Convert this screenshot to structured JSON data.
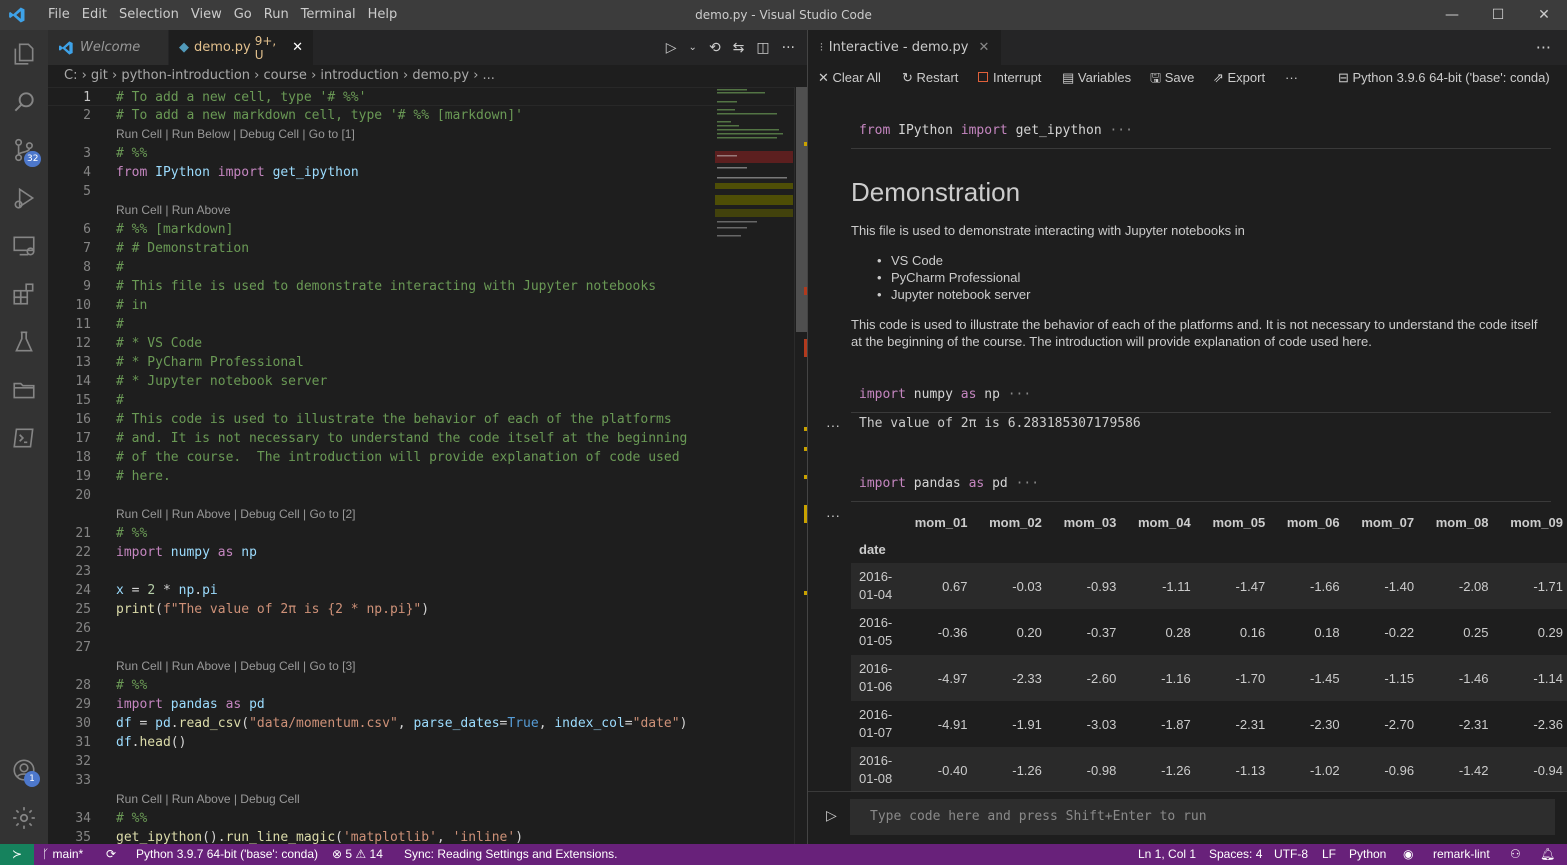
{
  "titlebar": {
    "menu": [
      "File",
      "Edit",
      "Selection",
      "View",
      "Go",
      "Run",
      "Terminal",
      "Help"
    ],
    "title": "demo.py - Visual Studio Code",
    "minimize": "—",
    "maximize": "☐",
    "close": "✕"
  },
  "tabs": {
    "welcome": "Welcome",
    "demo": "demo.py",
    "demo_status": "9+, U",
    "close": "✕"
  },
  "breadcrumb": "C: › git › python-introduction › course › introduction › demo.py › ...",
  "activity": {
    "scm_badge": "32",
    "accounts_badge": "1"
  },
  "editor": {
    "lines": [
      {
        "n": "1",
        "code": "# To add a new cell, type '# %%'"
      },
      {
        "n": "2",
        "code": "# To add a new markdown cell, type '# %% [markdown]'"
      },
      {
        "lens": "Run Cell | Run Below | Debug Cell | Go to [1]"
      },
      {
        "n": "3",
        "code": "# %%"
      },
      {
        "n": "4",
        "code": "from IPython import get_ipython"
      },
      {
        "n": "5",
        "code": ""
      },
      {
        "lens": "Run Cell | Run Above"
      },
      {
        "n": "6",
        "code": "# %% [markdown]"
      },
      {
        "n": "7",
        "code": "# # Demonstration"
      },
      {
        "n": "8",
        "code": "#"
      },
      {
        "n": "9",
        "code": "# This file is used to demonstrate interacting with Jupyter notebooks"
      },
      {
        "n": "10",
        "code": "# in"
      },
      {
        "n": "11",
        "code": "#"
      },
      {
        "n": "12",
        "code": "# * VS Code"
      },
      {
        "n": "13",
        "code": "# * PyCharm Professional"
      },
      {
        "n": "14",
        "code": "# * Jupyter notebook server"
      },
      {
        "n": "15",
        "code": "#"
      },
      {
        "n": "16",
        "code": "# This code is used to illustrate the behavior of each of the platforms"
      },
      {
        "n": "17",
        "code": "# and. It is not necessary to understand the code itself at the beginning"
      },
      {
        "n": "18",
        "code": "# of the course.  The introduction will provide explanation of code used"
      },
      {
        "n": "19",
        "code": "# here."
      },
      {
        "n": "20",
        "code": ""
      },
      {
        "lens": "Run Cell | Run Above | Debug Cell | Go to [2]"
      },
      {
        "n": "21",
        "code": "# %%"
      },
      {
        "n": "22",
        "code": "import numpy as np"
      },
      {
        "n": "23",
        "code": ""
      },
      {
        "n": "24",
        "code": "x = 2 * np.pi"
      },
      {
        "n": "25",
        "code": "print(f\"The value of 2π is {2 * np.pi}\")"
      },
      {
        "n": "26",
        "code": ""
      },
      {
        "n": "27",
        "code": ""
      },
      {
        "lens": "Run Cell | Run Above | Debug Cell | Go to [3]"
      },
      {
        "n": "28",
        "code": "# %%"
      },
      {
        "n": "29",
        "code": "import pandas as pd"
      },
      {
        "n": "30",
        "code": "df = pd.read_csv(\"data/momentum.csv\", parse_dates=True, index_col=\"date\")"
      },
      {
        "n": "31",
        "code": "df.head()"
      },
      {
        "n": "32",
        "code": ""
      },
      {
        "n": "33",
        "code": ""
      },
      {
        "lens": "Run Cell | Run Above | Debug Cell"
      },
      {
        "n": "34",
        "code": "# %%"
      },
      {
        "n": "35",
        "code": "get_ipython().run_line_magic('matplotlib', 'inline')"
      }
    ]
  },
  "interactive": {
    "tab": "Interactive - demo.py",
    "toolbar": {
      "clear": "Clear All",
      "restart": "Restart",
      "interrupt": "Interrupt",
      "variables": "Variables",
      "save": "Save",
      "export": "Export",
      "more": "···",
      "kernel": "Python 3.9.6 64-bit ('base': conda)"
    },
    "cell1": "from IPython import get_ipython ···",
    "md_title": "Demonstration",
    "md_p1": "This file is used to demonstrate interacting with Jupyter notebooks in",
    "md_list": [
      "VS Code",
      "PyCharm Professional",
      "Jupyter notebook server"
    ],
    "md_p2": "This code is used to illustrate the behavior of each of the platforms and. It is not necessary to understand the code itself at the beginning of the course. The introduction will provide explanation of code used here.",
    "cell2": "import numpy as np ···",
    "out2": "The value of 2π is 6.283185307179586",
    "cell3": "import pandas as pd ···",
    "ellipsis": "···",
    "table": {
      "columns": [
        "mom_01",
        "mom_02",
        "mom_03",
        "mom_04",
        "mom_05",
        "mom_06",
        "mom_07",
        "mom_08",
        "mom_09"
      ],
      "index_name": "date",
      "rows": [
        {
          "date": [
            "2016-",
            "01-04"
          ],
          "vals": [
            "0.67",
            "-0.03",
            "-0.93",
            "-1.11",
            "-1.47",
            "-1.66",
            "-1.40",
            "-2.08",
            "-1.71"
          ]
        },
        {
          "date": [
            "2016-",
            "01-05"
          ],
          "vals": [
            "-0.36",
            "0.20",
            "-0.37",
            "0.28",
            "0.16",
            "0.18",
            "-0.22",
            "0.25",
            "0.29"
          ]
        },
        {
          "date": [
            "2016-",
            "01-06"
          ],
          "vals": [
            "-4.97",
            "-2.33",
            "-2.60",
            "-1.16",
            "-1.70",
            "-1.45",
            "-1.15",
            "-1.46",
            "-1.14"
          ]
        },
        {
          "date": [
            "2016-",
            "01-07"
          ],
          "vals": [
            "-4.91",
            "-1.91",
            "-3.03",
            "-1.87",
            "-2.31",
            "-2.30",
            "-2.70",
            "-2.31",
            "-2.36"
          ]
        },
        {
          "date": [
            "2016-",
            "01-08"
          ],
          "vals": [
            "-0.40",
            "-1.26",
            "-0.98",
            "-1.26",
            "-1.13",
            "-1.02",
            "-0.96",
            "-1.42",
            "-0.94"
          ]
        }
      ]
    },
    "input_placeholder": "Type code here and press Shift+Enter to run"
  },
  "statusbar": {
    "branch": "main*",
    "python": "Python 3.9.7 64-bit ('base': conda)",
    "errors": "5",
    "warnings": "14",
    "sync": "Sync: Reading Settings and Extensions.",
    "position": "Ln 1, Col 1",
    "spaces": "Spaces: 4",
    "encoding": "UTF-8",
    "eol": "LF",
    "language": "Python",
    "lint": "remark-lint"
  },
  "colors": {
    "statusbar": "#68217a",
    "activity": "#333333",
    "editor": "#1e1e1e"
  }
}
